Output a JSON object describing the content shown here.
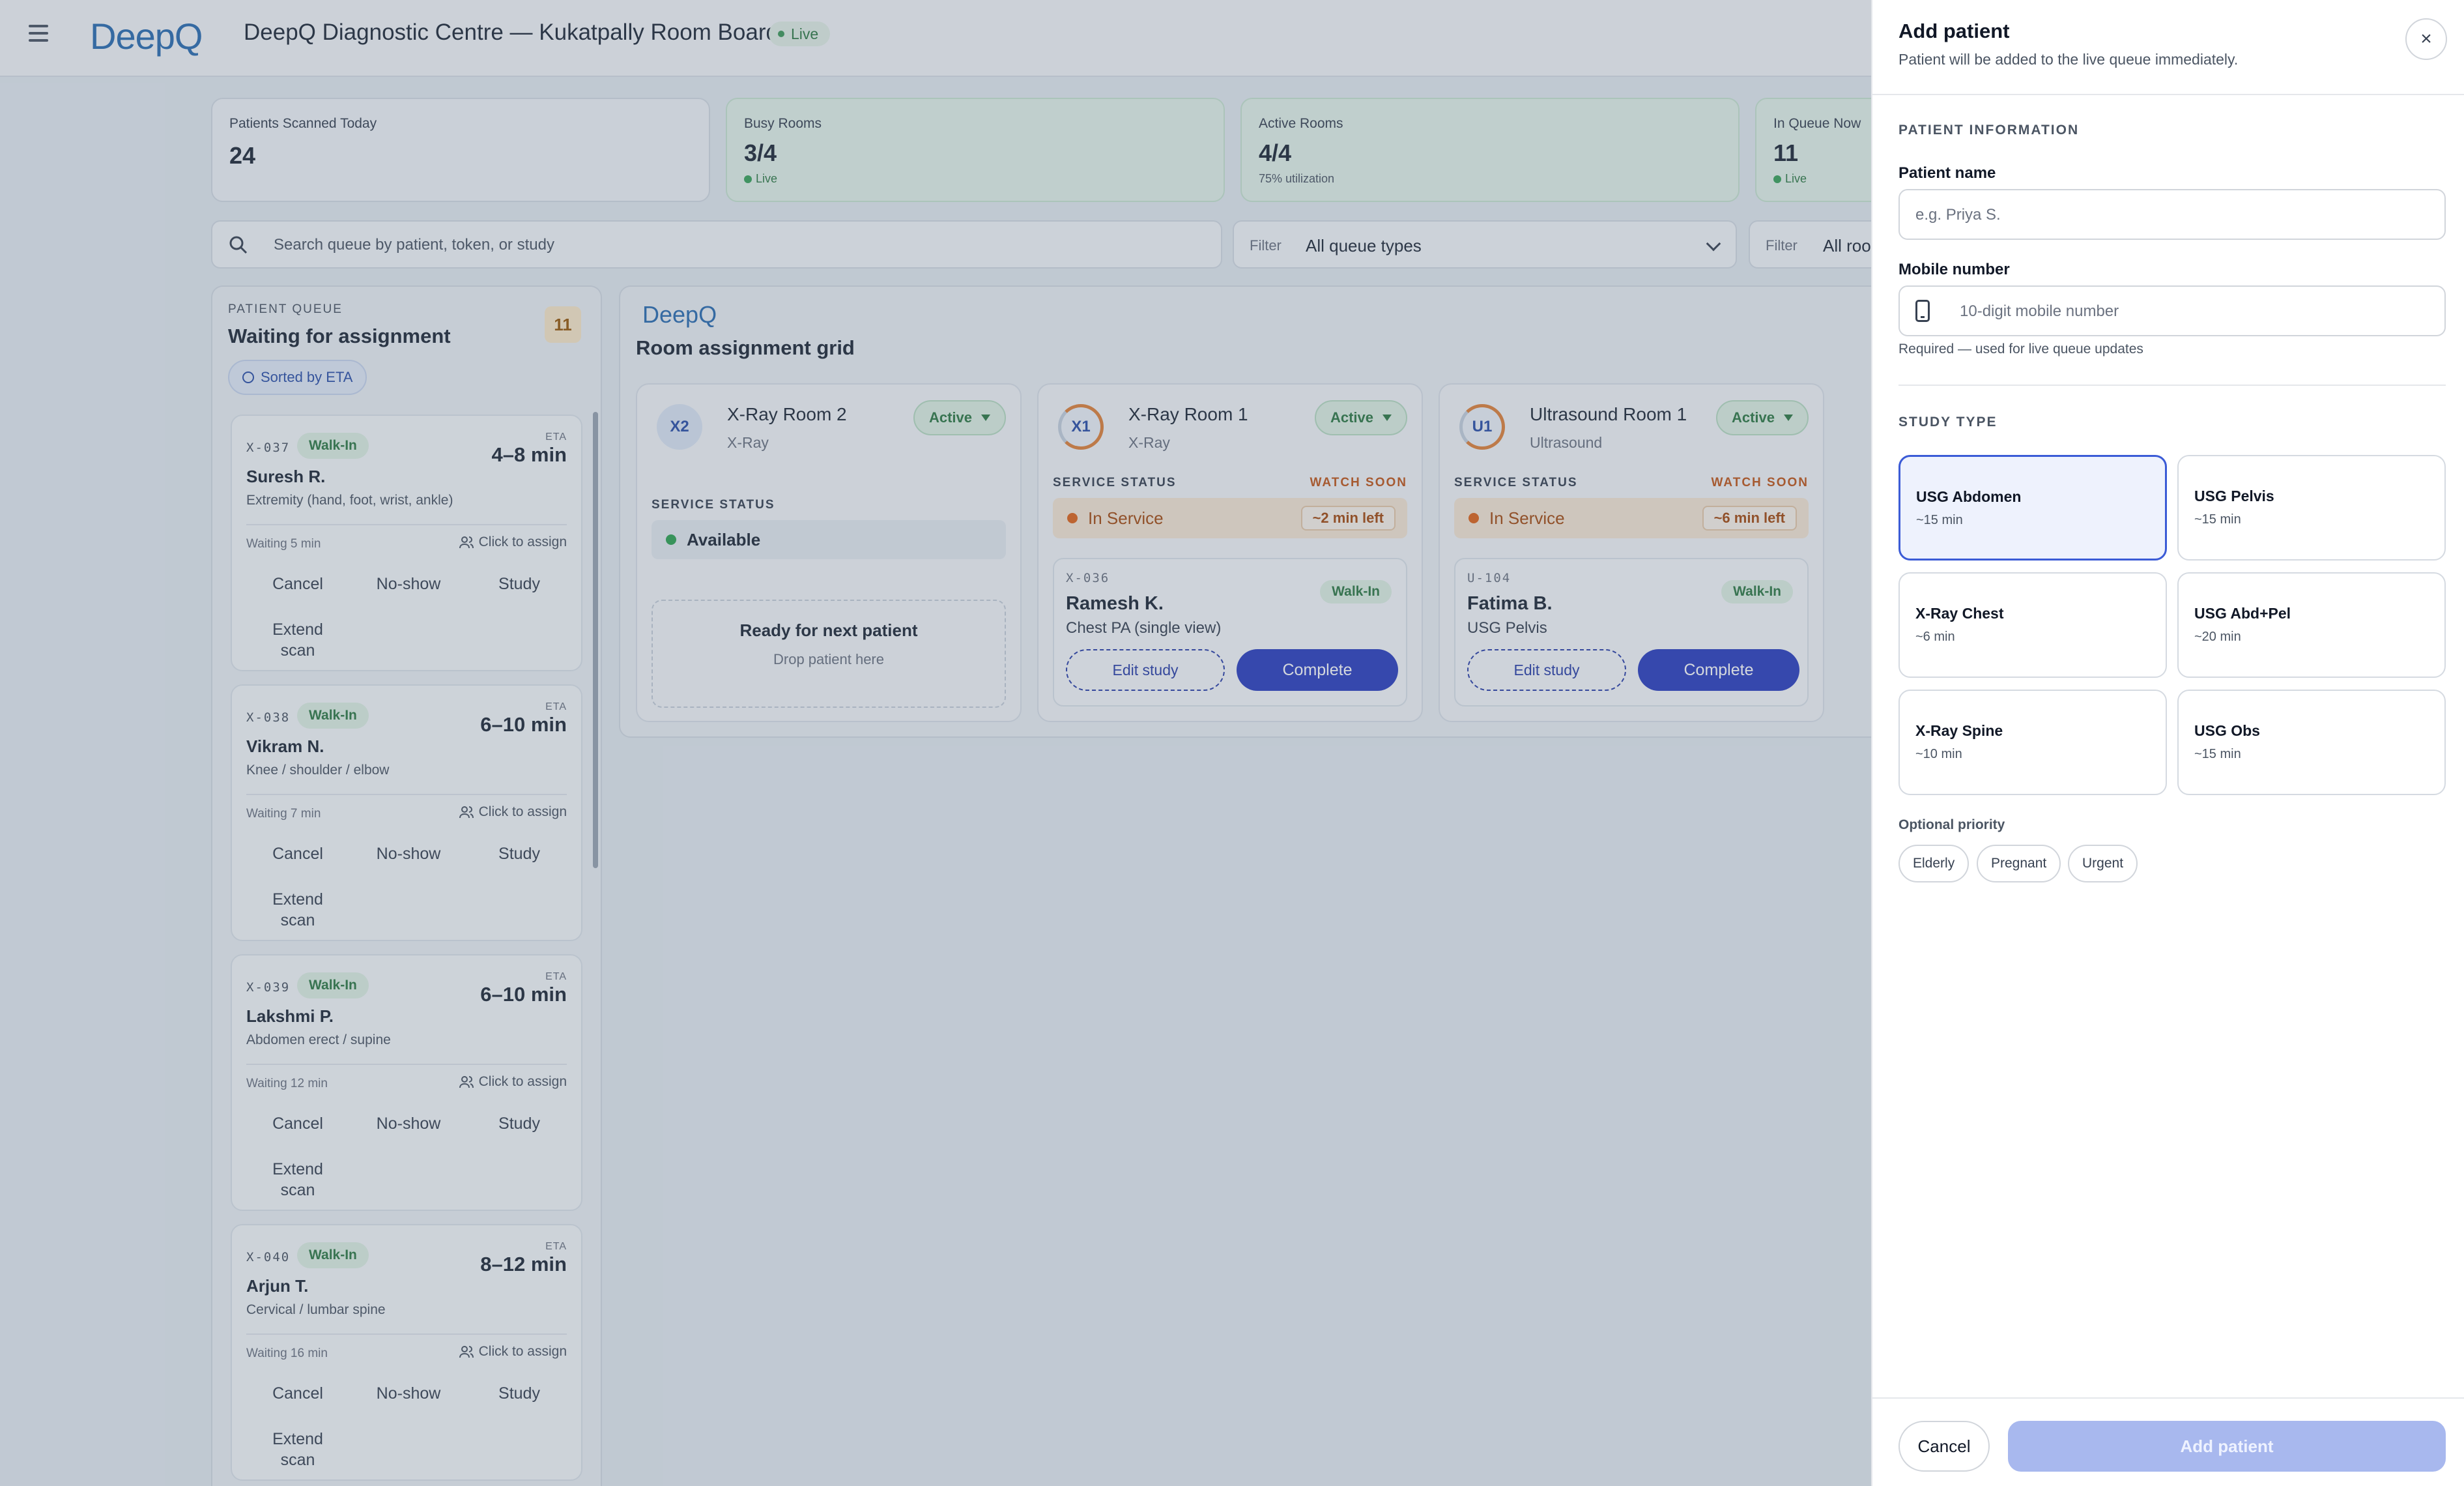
{
  "topbar": {
    "logo": "DeepQ",
    "title": "DeepQ Diagnostic Centre — Kukatpally Room Board",
    "live_label": "Live"
  },
  "stats": [
    {
      "label": "Patients Scanned Today",
      "value": "24",
      "sub": ""
    },
    {
      "label": "Busy Rooms",
      "value": "3/4",
      "sub": "Live"
    },
    {
      "label": "Active Rooms",
      "value": "4/4",
      "sub": "75% utilization"
    },
    {
      "label": "In Queue Now",
      "value": "11",
      "sub": "Live"
    }
  ],
  "search": {
    "placeholder": "Search queue by patient, token, or study"
  },
  "filters": [
    {
      "label": "Filter",
      "value": "All queue types"
    },
    {
      "label": "Filter",
      "value": "All rooms"
    }
  ],
  "queue": {
    "eyebrow": "PATIENT QUEUE",
    "title": "Waiting for assignment",
    "count": "11",
    "sort_label": "Sorted by ETA",
    "cards": [
      {
        "token": "X-037",
        "badge": "Walk-In",
        "eta_label": "ETA",
        "eta": "4–8 min",
        "name": "Suresh R.",
        "study": "Extremity (hand, foot, wrist, ankle)",
        "waiting": "Waiting 5 min",
        "assign": "Click to assign",
        "actions": [
          "Cancel",
          "No-show",
          "Study",
          "Extend scan"
        ]
      },
      {
        "token": "X-038",
        "badge": "Walk-In",
        "eta_label": "ETA",
        "eta": "6–10 min",
        "name": "Vikram N.",
        "study": "Knee / shoulder / elbow",
        "waiting": "Waiting 7 min",
        "assign": "Click to assign",
        "actions": [
          "Cancel",
          "No-show",
          "Study",
          "Extend scan"
        ]
      },
      {
        "token": "X-039",
        "badge": "Walk-In",
        "eta_label": "ETA",
        "eta": "6–10 min",
        "name": "Lakshmi P.",
        "study": "Abdomen erect / supine",
        "waiting": "Waiting 12 min",
        "assign": "Click to assign",
        "actions": [
          "Cancel",
          "No-show",
          "Study",
          "Extend scan"
        ]
      },
      {
        "token": "X-040",
        "badge": "Walk-In",
        "eta_label": "ETA",
        "eta": "8–12 min",
        "name": "Arjun T.",
        "study": "Cervical / lumbar spine",
        "waiting": "Waiting 16 min",
        "assign": "Click to assign",
        "actions": [
          "Cancel",
          "No-show",
          "Study",
          "Extend scan"
        ]
      }
    ]
  },
  "rooms": {
    "logo": "DeepQ",
    "title": "Room assignment grid",
    "list": [
      {
        "code": "X2",
        "name": "X-Ray Room 2",
        "type": "X-Ray",
        "status": "Active",
        "service_label": "SERVICE STATUS",
        "service": "Available",
        "drop_title": "Ready for next patient",
        "drop_sub": "Drop patient here"
      },
      {
        "code": "X1",
        "name": "X-Ray Room 1",
        "type": "X-Ray",
        "status": "Active",
        "service_label": "SERVICE STATUS",
        "watch": "WATCH SOON",
        "service": "In Service",
        "time_left": "~2 min left",
        "patient": {
          "token": "X-036",
          "badge": "Walk-In",
          "name": "Ramesh K.",
          "study": "Chest PA (single view)",
          "edit": "Edit study",
          "complete": "Complete"
        }
      },
      {
        "code": "U1",
        "name": "Ultrasound Room 1",
        "type": "Ultrasound",
        "status": "Active",
        "service_label": "SERVICE STATUS",
        "watch": "WATCH SOON",
        "service": "In Service",
        "time_left": "~6 min left",
        "patient": {
          "token": "U-104",
          "badge": "Walk-In",
          "name": "Fatima B.",
          "study": "USG Pelvis",
          "edit": "Edit study",
          "complete": "Complete"
        }
      }
    ]
  },
  "drawer": {
    "title": "Add patient",
    "subtitle": "Patient will be added to the live queue immediately.",
    "close_icon": "×",
    "section_info": "PATIENT INFORMATION",
    "name_label": "Patient name",
    "name_placeholder": "e.g. Priya S.",
    "mobile_label": "Mobile number",
    "mobile_placeholder": "10-digit mobile number",
    "mobile_help": "Required — used for live queue updates",
    "section_study": "STUDY TYPE",
    "studies": [
      {
        "name": "USG Abdomen",
        "duration": "~15 min",
        "selected": true
      },
      {
        "name": "USG Pelvis",
        "duration": "~15 min",
        "selected": false
      },
      {
        "name": "X-Ray Chest",
        "duration": "~6 min",
        "selected": false
      },
      {
        "name": "USG Abd+Pel",
        "duration": "~20 min",
        "selected": false
      },
      {
        "name": "X-Ray Spine",
        "duration": "~10 min",
        "selected": false
      },
      {
        "name": "USG Obs",
        "duration": "~15 min",
        "selected": false
      }
    ],
    "priority_label": "Optional priority",
    "priorities": [
      "Elderly",
      "Pregnant",
      "Urgent"
    ],
    "cancel": "Cancel",
    "submit": "Add patient"
  },
  "colors": {
    "accent": "#2d3fbf",
    "live_green": "#2f7a44",
    "warning_orange": "#c2571a",
    "selected_border": "#3b5bd6"
  }
}
